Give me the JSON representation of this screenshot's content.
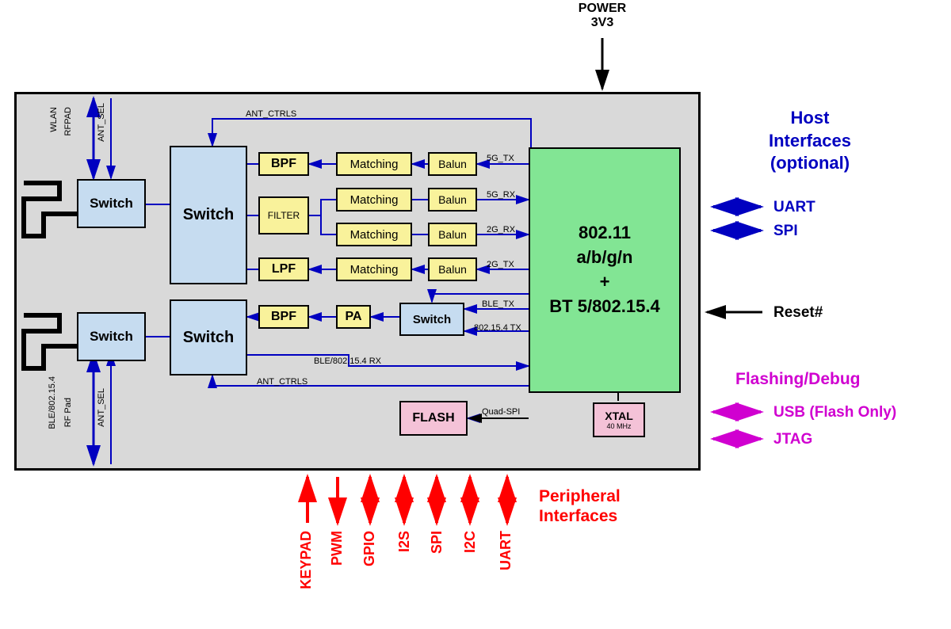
{
  "power": {
    "label1": "POWER",
    "label2": "3V3"
  },
  "module": {
    "ant1_labels": [
      "WLAN",
      "RFPAD",
      "ANT_SEL"
    ],
    "ant2_labels": [
      "BLE/802.15.4",
      "RF Pad",
      "ANT_SEL"
    ],
    "blocks": {
      "switch1": "Switch",
      "switch2": "Switch",
      "switch3": "Switch",
      "switch4": "Switch",
      "switch5": "Switch",
      "bpf1": "BPF",
      "filter": "FILTER",
      "lpf": "LPF",
      "bpf2": "BPF",
      "pa": "PA",
      "m1": "Matching",
      "m2": "Matching",
      "m3": "Matching",
      "m4": "Matching",
      "b1": "Balun",
      "b2": "Balun",
      "b3": "Balun",
      "b4": "Balun",
      "flash": "FLASH",
      "xtal": "XTAL",
      "xtal_sub": "40 MHz",
      "chip": "802.11\na/b/g/n\n+\nBT 5/802.15.4"
    },
    "signals": {
      "ant_ctrls": "ANT_CTRLS",
      "tx5g": "5G_TX",
      "rx5g": "5G_RX",
      "rx2g": "2G_RX",
      "tx2g": "2G_TX",
      "ble_tx": "BLE_TX",
      "ble_tx2": "802.15.4 TX",
      "ble_rx": "BLE/802.15.4 RX",
      "quadspi": "Quad-SPI"
    }
  },
  "host": {
    "title": "Host\nInterfaces\n(optional)",
    "uart": "UART",
    "spi": "SPI",
    "reset": "Reset#"
  },
  "flash_debug": {
    "title": "Flashing/Debug",
    "usb": "USB (Flash Only)",
    "jtag": "JTAG"
  },
  "periph": {
    "title": "Peripheral\nInterfaces",
    "items": [
      "KEYPAD",
      "PWM",
      "GPIO",
      "I2S",
      "SPI",
      "I2C",
      "UART"
    ]
  }
}
